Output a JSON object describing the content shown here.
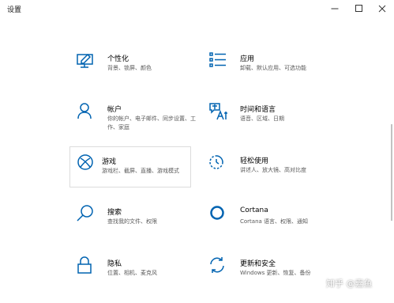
{
  "window": {
    "title": "设置"
  },
  "accent": "#0063b1",
  "categories": [
    {
      "icon": "display-pen-icon",
      "name": "个性化",
      "desc": "背景、锁屏、颜色"
    },
    {
      "icon": "apps-list-icon",
      "name": "应用",
      "desc": "卸载、默认应用、可选功能"
    },
    {
      "icon": "person-icon",
      "name": "帐户",
      "desc": "你的帐户、电子邮件、同步设置、工作、家庭"
    },
    {
      "icon": "time-language-icon",
      "name": "时间和语言",
      "desc": "语音、区域、日期"
    },
    {
      "icon": "xbox-icon",
      "name": "游戏",
      "desc": "游戏栏、截屏、直播、游戏模式"
    },
    {
      "icon": "ease-of-access-icon",
      "name": "轻松使用",
      "desc": "讲述人、放大镜、高对比度"
    },
    {
      "icon": "search-icon",
      "name": "搜索",
      "desc": "查找我的文件、权限"
    },
    {
      "icon": "cortana-icon",
      "name": "Cortana",
      "desc": "Cortana 语言、权限、通知"
    },
    {
      "icon": "lock-icon",
      "name": "隐私",
      "desc": "位置、相机、麦克风"
    },
    {
      "icon": "update-icon",
      "name": "更新和安全",
      "desc": "Windows 更新、恢复、备份"
    }
  ],
  "watermark": "知乎 @嘉鱼"
}
